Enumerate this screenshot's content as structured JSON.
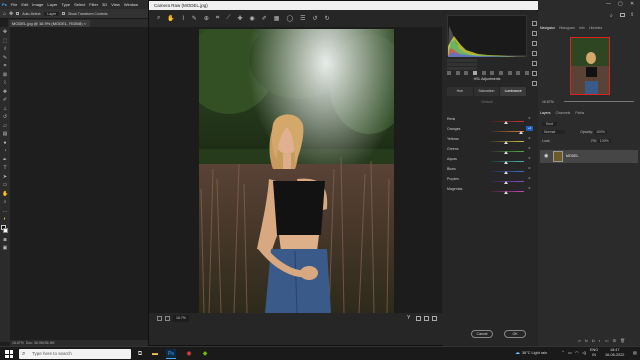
{
  "menubar": {
    "items": [
      "File",
      "Edit",
      "Image",
      "Layer",
      "Type",
      "Select",
      "Filter",
      "3D",
      "View",
      "Window"
    ]
  },
  "optionsbar": {
    "auto_select": "Auto-Select:",
    "layer": "Layer",
    "transform": "Show Transform Controls"
  },
  "doc_tab": "MODEL.jpg @ 16.9% (MODEL, RGB/8)",
  "ps_status": "16.67%",
  "ps_status_doc": "Doc: 36.9M/36.9M",
  "camera_raw": {
    "title": "Camera Raw (MODEL.jpg)",
    "panel_title": "HSL Adjustments",
    "tabs": [
      "Hue",
      "Saturation",
      "Luminance"
    ],
    "active_tab": "Luminance",
    "default_label": "Default",
    "sliders": [
      {
        "label": "Reds",
        "value": "0",
        "pos": 0.5,
        "gradient": "linear-gradient(90deg,#222,#c33)"
      },
      {
        "label": "Oranges",
        "value": "+4",
        "pos": 0.93,
        "gradient": "linear-gradient(90deg,#222,#d7823a)"
      },
      {
        "label": "Yellows",
        "value": "0",
        "pos": 0.5,
        "gradient": "linear-gradient(90deg,#222,#d3c341)"
      },
      {
        "label": "Greens",
        "value": "0",
        "pos": 0.5,
        "gradient": "linear-gradient(90deg,#222,#4fae47)"
      },
      {
        "label": "Aquas",
        "value": "0",
        "pos": 0.5,
        "gradient": "linear-gradient(90deg,#222,#3fb8b0)"
      },
      {
        "label": "Blues",
        "value": "0",
        "pos": 0.5,
        "gradient": "linear-gradient(90deg,#222,#3f6bd0)"
      },
      {
        "label": "Purples",
        "value": "0",
        "pos": 0.5,
        "gradient": "linear-gradient(90deg,#222,#8c4bd3)"
      },
      {
        "label": "Magentas",
        "value": "0",
        "pos": 0.5,
        "gradient": "linear-gradient(90deg,#222,#cf44b6)"
      }
    ],
    "zoom": "16.7%",
    "cancel_label": "Cancel",
    "ok_label": "OK"
  },
  "ps_panels": {
    "nav_tabs": [
      "Navigator",
      "Histogram",
      "Info",
      "Libraries"
    ],
    "nav_zoom": "16.67%",
    "layers_tabs": [
      "Layers",
      "Channels",
      "Paths"
    ],
    "kind_label": "Kind",
    "blend_mode": "Normal",
    "opacity_label": "Opacity:",
    "opacity_value": "100%",
    "lock_label": "Lock:",
    "fill_label": "Fill:",
    "fill_value": "100%",
    "layer_name": "MODEL"
  },
  "taskbar": {
    "search_placeholder": "Type here to search",
    "weather": "36°C  Light rain",
    "lang": "ENG",
    "region": "IN",
    "time": "18:47",
    "date": "16-06-2022"
  }
}
